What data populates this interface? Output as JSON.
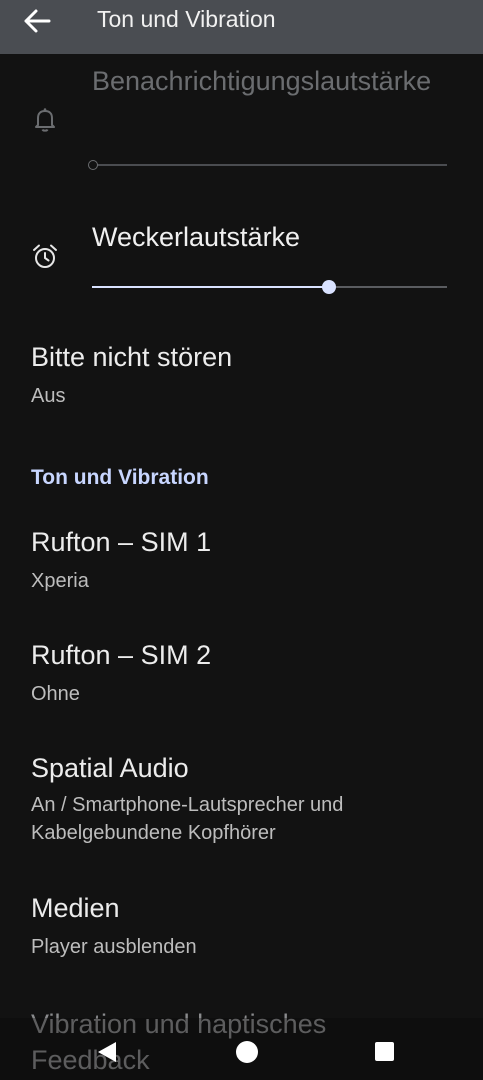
{
  "appbar": {
    "title": "Ton und Vibration"
  },
  "notification_volume": {
    "label": "Benachrichtigungslautstärke",
    "level": 0,
    "enabled": false
  },
  "alarm_volume": {
    "label": "Weckerlautstärke",
    "level": 0.667
  },
  "do_not_disturb": {
    "title": "Bitte nicht stören",
    "summary": "Aus"
  },
  "section": {
    "header": "Ton und Vibration"
  },
  "items": [
    {
      "title": "Rufton – SIM 1",
      "summary": "Xperia"
    },
    {
      "title": "Rufton – SIM 2",
      "summary": "Ohne"
    },
    {
      "title": "Spatial Audio",
      "summary": "An / Smartphone-Lautsprecher und Kabelgebundene Kopfhörer"
    },
    {
      "title": "Medien",
      "summary": "Player ausblenden"
    },
    {
      "title": "Vibration und haptisches Feedback"
    }
  ],
  "icons": {
    "back": "arrow-left-icon",
    "notification": "bell-icon",
    "alarm": "alarm-clock-icon"
  },
  "colors": {
    "appbar": "#4a4d52",
    "background": "#121212",
    "accent": "#d9e2ff",
    "section_header": "#c8d6ff"
  }
}
